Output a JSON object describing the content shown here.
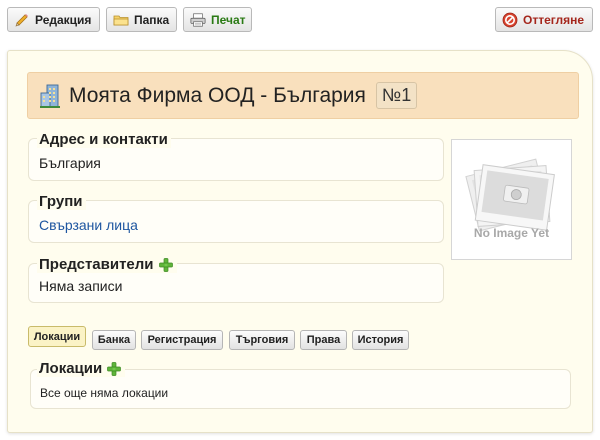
{
  "toolbar": {
    "edit_label": "Редакция",
    "folder_label": "Папка",
    "print_label": "Печат",
    "reject_label": "Оттегляне"
  },
  "header": {
    "title": "Моята Фирма ООД - България",
    "number": "№1"
  },
  "address": {
    "legend": "Адрес и контакти",
    "value": "България"
  },
  "groups": {
    "legend": "Групи",
    "value": "Свързани лица"
  },
  "representatives": {
    "legend": "Представители",
    "value": "Няма записи"
  },
  "image_placeholder": {
    "caption": "No Image Yet"
  },
  "tabs": [
    {
      "label": "Локации",
      "active": true
    },
    {
      "label": "Банка",
      "active": false
    },
    {
      "label": "Регистрация",
      "active": false
    },
    {
      "label": "Търговия",
      "active": false
    },
    {
      "label": "Права",
      "active": false
    },
    {
      "label": "История",
      "active": false
    }
  ],
  "locations": {
    "legend": "Локации",
    "value": "Все още няма локации"
  },
  "colors": {
    "card_background": "#fffdee",
    "title_bar": "#f9e0bd",
    "print_text": "#2a7a14",
    "reject_text": "#a4251b",
    "link": "#1e56a0",
    "active_tab": "#fbf3c6"
  },
  "icons": {
    "edit": "pencil-icon",
    "folder": "folder-icon",
    "print": "printer-icon",
    "reject": "reject-icon",
    "company": "building-icon",
    "add": "plus-icon",
    "photo": "photo-stack-icon"
  }
}
